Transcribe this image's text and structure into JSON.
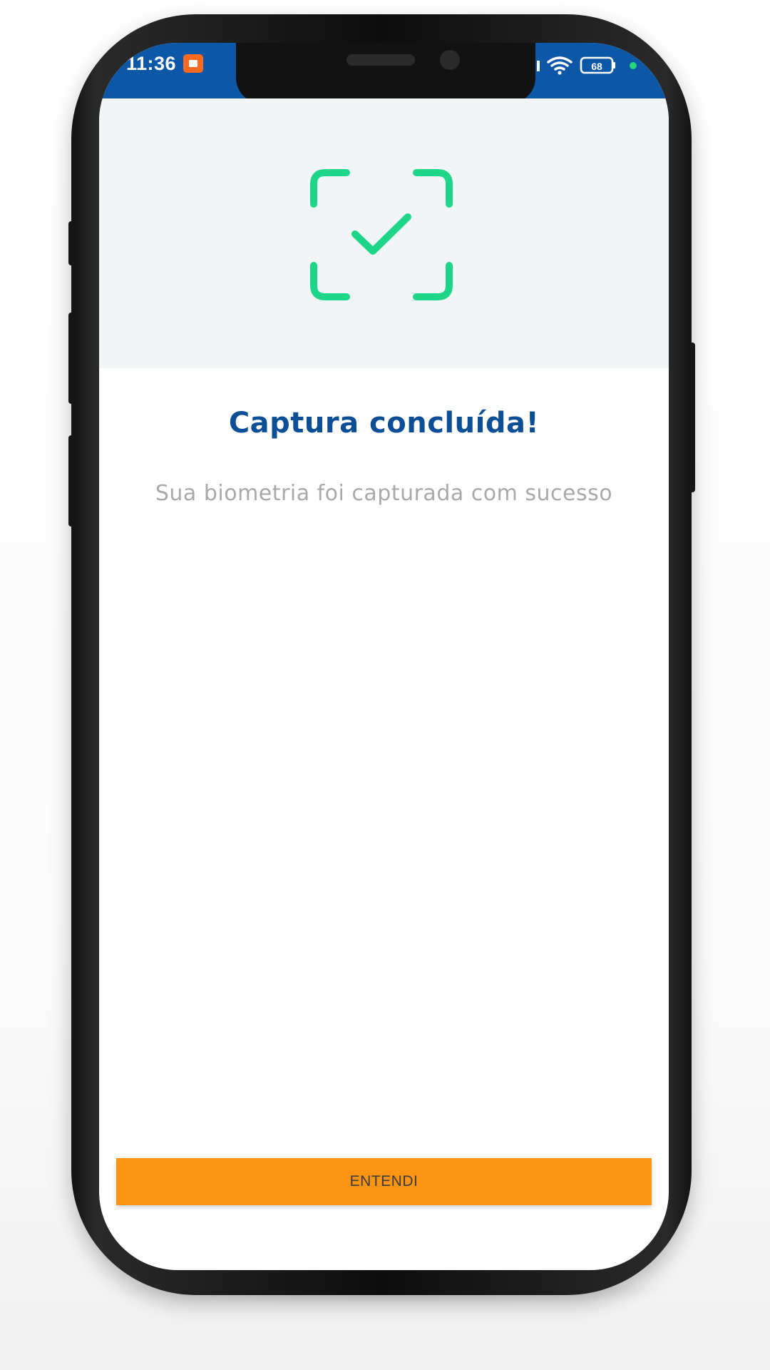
{
  "status_bar": {
    "time": "11:36",
    "battery_level": "68",
    "background_color": "#0c57a6",
    "icons": [
      "app-notification-icon",
      "signal-icon",
      "wifi-icon",
      "battery-icon",
      "charging-dot-icon"
    ]
  },
  "hero": {
    "icon": "face-scan-check-icon",
    "icon_color": "#1ed68a",
    "background_color": "#f2f5f5"
  },
  "content": {
    "title": "Captura concluída!",
    "subtitle": "Sua biometria foi capturada com sucesso",
    "title_color": "#0c4f97",
    "subtitle_color": "#a9a9a9"
  },
  "actions": {
    "confirm_label": "ENTENDI",
    "confirm_color": "#fb9513"
  }
}
